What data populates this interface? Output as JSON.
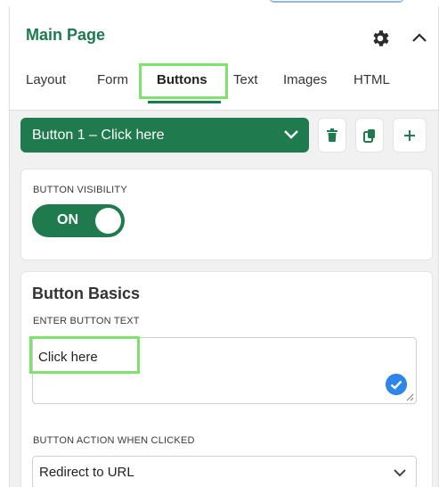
{
  "header": {
    "title": "Main Page",
    "icons": {
      "settings": "gear-icon",
      "collapse": "chevron-up-icon"
    }
  },
  "tabs": [
    {
      "label": "Layout",
      "active": false
    },
    {
      "label": "Form",
      "active": false
    },
    {
      "label": "Buttons",
      "active": true
    },
    {
      "label": "Text",
      "active": false
    },
    {
      "label": "Images",
      "active": false
    },
    {
      "label": "HTML",
      "active": false
    }
  ],
  "button_bar": {
    "selected": "Button 1 – Click here",
    "icons": [
      "chevron-down-icon",
      "trash-icon",
      "copy-icon",
      "plus-icon"
    ]
  },
  "visibility": {
    "label": "BUTTON VISIBILITY",
    "toggle_text": "ON",
    "on": true
  },
  "basics": {
    "title": "Button Basics",
    "text_label": "ENTER BUTTON TEXT",
    "text_value": "Click here",
    "action_label": "BUTTON ACTION WHEN CLICKED",
    "action_value": "Redirect to URL"
  },
  "colors": {
    "brand_green": "#1f7a4d",
    "highlight": "#7de36a",
    "check_blue": "#2f86e8"
  }
}
